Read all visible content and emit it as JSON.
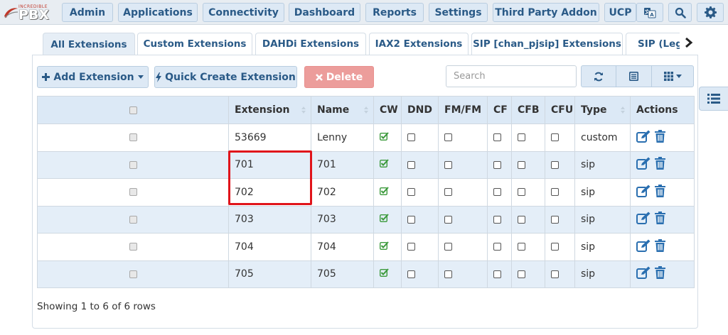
{
  "brand": {
    "logo_small": "INCREDIBLE",
    "logo_main": "PBX"
  },
  "nav": {
    "items": [
      "Admin",
      "Applications",
      "Connectivity",
      "Dashboard",
      "Reports",
      "Settings",
      "Third Party Addon",
      "UCP"
    ],
    "icons": [
      "language-icon",
      "search-icon",
      "gear-icon"
    ]
  },
  "tabs": [
    {
      "label": "All Extensions",
      "active": true
    },
    {
      "label": "Custom Extensions",
      "active": false
    },
    {
      "label": "DAHDi Extensions",
      "active": false
    },
    {
      "label": "IAX2 Extensions",
      "active": false
    },
    {
      "label": "SIP [chan_pjsip] Extensions",
      "active": false
    },
    {
      "label": "SIP (Lega",
      "active": false
    }
  ],
  "toolbar": {
    "add_label": "Add Extension",
    "quick_label": "Quick Create Extension",
    "delete_label": "Delete",
    "search_placeholder": "Search"
  },
  "table": {
    "columns": [
      "Extension",
      "Name",
      "CW",
      "DND",
      "FM/FM",
      "CF",
      "CFB",
      "CFU",
      "Type",
      "Actions"
    ],
    "rows": [
      {
        "extension": "53669",
        "name": "Lenny",
        "cw": true,
        "type": "custom"
      },
      {
        "extension": "701",
        "name": "701",
        "cw": true,
        "type": "sip"
      },
      {
        "extension": "702",
        "name": "702",
        "cw": true,
        "type": "sip"
      },
      {
        "extension": "703",
        "name": "703",
        "cw": true,
        "type": "sip"
      },
      {
        "extension": "704",
        "name": "704",
        "cw": true,
        "type": "sip"
      },
      {
        "extension": "705",
        "name": "705",
        "cw": true,
        "type": "sip"
      }
    ]
  },
  "footer": {
    "status": "Showing 1 to 6 of 6 rows"
  },
  "colors": {
    "accent": "#2a5a87",
    "header_bg": "#dce9f6",
    "alt_row": "#e4eef8",
    "danger": "#ec9d9b",
    "check_green": "#3c9a3c",
    "highlight_red": "#e0141b"
  }
}
